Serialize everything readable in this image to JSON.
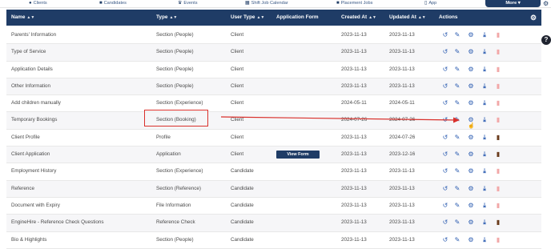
{
  "topnav": {
    "tabs": [
      {
        "label": "Clients",
        "icon": "users-icon"
      },
      {
        "label": "Candidates",
        "icon": "briefcase-icon"
      },
      {
        "label": "Events",
        "icon": "trophy-icon"
      },
      {
        "label": "Shift Job Calendar",
        "icon": "calendar-icon"
      },
      {
        "label": "Placement Jobs",
        "icon": "case-icon"
      },
      {
        "label": "App",
        "icon": "phone-icon"
      }
    ],
    "more_label": "More ▾"
  },
  "table": {
    "headers": {
      "name": "Name",
      "type": "Type",
      "user_type": "User Type",
      "application_form": "Application Form",
      "created_at": "Created At",
      "updated_at": "Updated At",
      "actions": "Actions"
    },
    "rows": [
      {
        "name": "Parents' Information",
        "type": "Section (People)",
        "user_type": "Client",
        "form": "",
        "created": "2023-11-13",
        "updated": "2023-11-13",
        "delete_style": "light"
      },
      {
        "name": "Type of Service",
        "type": "Section (People)",
        "user_type": "Client",
        "form": "",
        "created": "2023-11-13",
        "updated": "2023-11-13",
        "delete_style": "light"
      },
      {
        "name": "Application Details",
        "type": "Section (People)",
        "user_type": "Client",
        "form": "",
        "created": "2023-11-13",
        "updated": "2023-11-13",
        "delete_style": "light"
      },
      {
        "name": "Other Information",
        "type": "Section (People)",
        "user_type": "Client",
        "form": "",
        "created": "2023-11-13",
        "updated": "2023-11-13",
        "delete_style": "light"
      },
      {
        "name": "Add children manually",
        "type": "Section (Experience)",
        "user_type": "Client",
        "form": "",
        "created": "2024-05-11",
        "updated": "2024-05-11",
        "delete_style": "light"
      },
      {
        "name": "Temporary Bookings",
        "type": "Section (Booking)",
        "user_type": "Client",
        "form": "",
        "created": "2024-07-26",
        "updated": "2024-07-26",
        "delete_style": "light"
      },
      {
        "name": "Client Profile",
        "type": "Profile",
        "user_type": "Client",
        "form": "",
        "created": "2023-11-13",
        "updated": "2024-07-26",
        "delete_style": "dark"
      },
      {
        "name": "Client Application",
        "type": "Application",
        "user_type": "Client",
        "form": "View Form",
        "created": "2023-11-13",
        "updated": "2023-12-16",
        "delete_style": "dark"
      },
      {
        "name": "Employment History",
        "type": "Section (Experience)",
        "user_type": "Candidate",
        "form": "",
        "created": "2023-11-13",
        "updated": "2023-11-13",
        "delete_style": "light"
      },
      {
        "name": "Reference",
        "type": "Section (Reference)",
        "user_type": "Candidate",
        "form": "",
        "created": "2023-11-13",
        "updated": "2023-11-13",
        "delete_style": "light"
      },
      {
        "name": "Document with Expiry",
        "type": "File Information",
        "user_type": "Candidate",
        "form": "",
        "created": "2023-11-13",
        "updated": "2023-11-13",
        "delete_style": "light"
      },
      {
        "name": "EngineHire - Reference Check Questions",
        "type": "Reference Check",
        "user_type": "Candidate",
        "form": "",
        "created": "2023-11-13",
        "updated": "2023-11-13",
        "delete_style": "dark"
      },
      {
        "name": "Bio & Highlights",
        "type": "Section (People)",
        "user_type": "Candidate",
        "form": "",
        "created": "2023-11-13",
        "updated": "2023-11-13",
        "delete_style": "light"
      }
    ]
  },
  "colors": {
    "header_bg": "#1f3c66",
    "annotation": "#d9302b",
    "action_blue": "#2a5bb0"
  }
}
